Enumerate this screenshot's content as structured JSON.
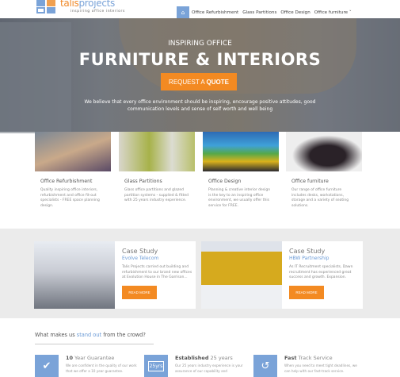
{
  "logo": {
    "brand_a": "talis",
    "brand_b": "projects",
    "tagline": "inspiring office interiors"
  },
  "nav": {
    "home_icon": "home-icon",
    "items": [
      "Office Refurbishment",
      "Glass Partitions",
      "Office Design",
      "Office furniture"
    ],
    "dropdown_caret": "˅"
  },
  "hero": {
    "subtitle": "INSPIRING OFFICE",
    "title": "FURNITURE & INTERIORS",
    "cta_light": "REQUEST A ",
    "cta_bold": "QUOTE",
    "text": "We believe that every office environment should be inspiring, encourage positive attitudes, good communication levels and sense of self worth and well being"
  },
  "services": [
    {
      "title": "Office Refurbishment",
      "text": "Quality inspiring office interiors, refurbishment and office fit-out specialists - FREE space planning design."
    },
    {
      "title": "Glass Partitions",
      "text": "Glass office partitions and glazed partition systems - supplied & fitted with 25 years industry experience."
    },
    {
      "title": "Office Design",
      "text": "Planning & creative interior design is the key to an inspiring office environment, we usually offer this service for FREE."
    },
    {
      "title": "Office furniture",
      "text": "Our range of office furniture includes desks, workstations, storage and a variety of seating solutions."
    }
  ],
  "cases": [
    {
      "label": "Case Study",
      "client": "Evolve Telecom",
      "text": "Talis Projects carried out building and refurbishment to our brand new offices at Evolution House in The Garrison...",
      "button": "READ MORE"
    },
    {
      "label": "Case Study",
      "client": "HBW Partnership",
      "text": "As IT Recruitment specialists, Dawn recruitment has experienced great success and growth. Expansion.",
      "button": "READ MORE"
    }
  ],
  "why": {
    "pre": "What makes us ",
    "highlight": "stand out",
    "post": " from the crowd?"
  },
  "features": [
    {
      "icon": "check-badge-icon",
      "bold": "10",
      "title": " Year Guarantee",
      "text": "We are confident in the quality of our work that we offer a 10 year guarantee."
    },
    {
      "icon": "calendar-icon",
      "icon_text": "25yrs",
      "bold": "Established",
      "title": " 25 years",
      "text": "Our 25 years industry experience is your assurance of our capability and"
    },
    {
      "icon": "history-icon",
      "bold": "Fast",
      "title": " Track Service",
      "text": "When you need to meet tight deadlines, we can help with our fast-track service."
    }
  ],
  "colors": {
    "accent_orange": "#f38a22",
    "accent_blue": "#7aa3d8"
  }
}
